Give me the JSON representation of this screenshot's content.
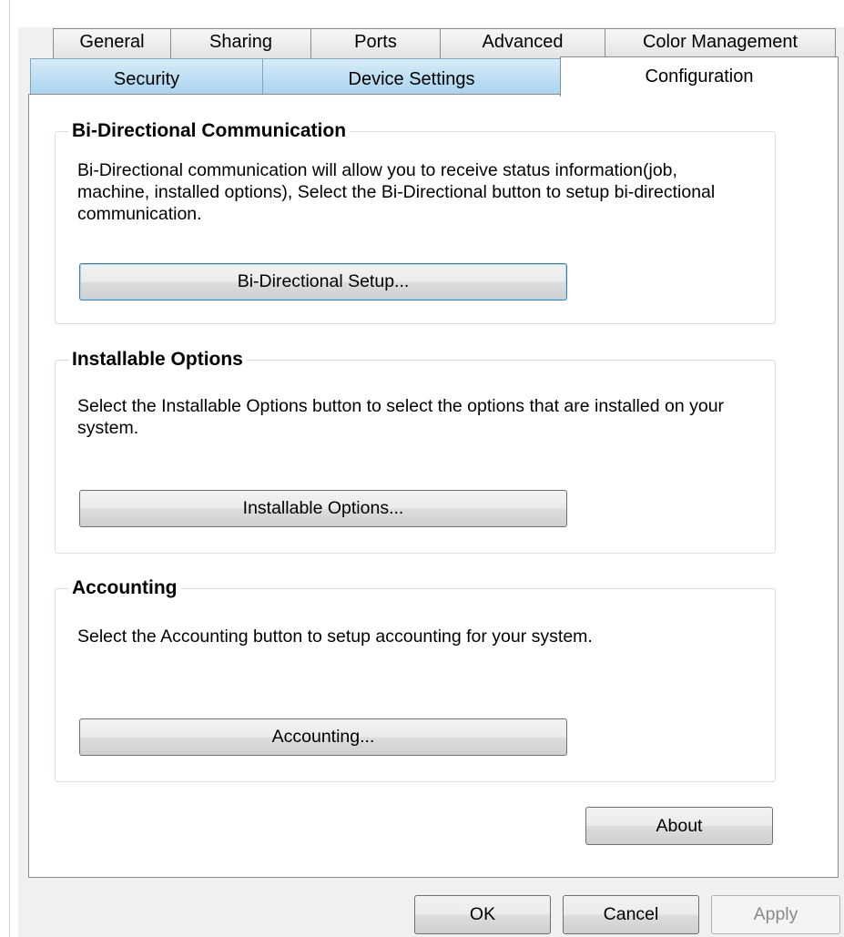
{
  "tabs_row1": [
    {
      "label": "General"
    },
    {
      "label": "Sharing"
    },
    {
      "label": "Ports"
    },
    {
      "label": "Advanced"
    },
    {
      "label": "Color Management"
    }
  ],
  "tabs_row2": [
    {
      "label": "Security"
    },
    {
      "label": "Device Settings"
    },
    {
      "label": "Configuration",
      "active": true
    }
  ],
  "groups": {
    "bidirectional": {
      "title": "Bi-Directional Communication",
      "description": "Bi-Directional communication will allow you to receive status information(job, machine, installed options), Select the Bi-Directional button to setup bi-directional communication.",
      "button": "Bi-Directional Setup..."
    },
    "installable": {
      "title": "Installable Options",
      "description": "Select the Installable Options button to select the options that are installed on your system.",
      "button": "Installable Options..."
    },
    "accounting": {
      "title": "Accounting",
      "description": "Select the Accounting button to setup accounting for your system.",
      "button": "Accounting..."
    }
  },
  "about_button": "About",
  "footer": {
    "ok": "OK",
    "cancel": "Cancel",
    "apply": "Apply"
  },
  "colors": {
    "selected_row_tab": "#a9d4ef",
    "focus_border": "#3c7fb1",
    "group_border": "#d5dfe5"
  }
}
